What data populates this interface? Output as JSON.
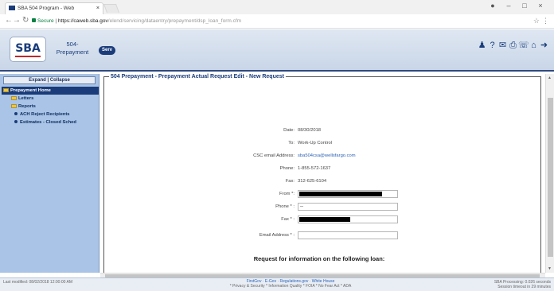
{
  "browser": {
    "tab_title": "SBA 504 Program - Web",
    "url_secure_label": "Secure",
    "url_host": "https://caweb.sba.gov",
    "url_path": "/elend/servicing/dataentry/prepayment/dsp_loan_form.cfm"
  },
  "header": {
    "logo_text": "SBA",
    "app_name_line1": "504-",
    "app_name_line2": "Prepayment",
    "serv_badge": "Serv",
    "icons": [
      "user-icon",
      "help-icon",
      "chat-icon",
      "print-icon",
      "phone-icon",
      "home-icon",
      "logout-icon"
    ]
  },
  "sidebar": {
    "expand_label": "Expand",
    "collapse_label": "Collapse",
    "home": "Prepayment Home",
    "items": [
      {
        "label": "Letters"
      },
      {
        "label": "Reports"
      },
      {
        "label": "ACH Reject Recipients"
      },
      {
        "label": "Estimates - Closed Sched"
      }
    ]
  },
  "form": {
    "legend": "504 Prepayment - Prepayment Actual Request Edit - New Request",
    "date_label": "Date:",
    "date_value": "08/30/2018",
    "to_label": "To:",
    "to_value": "Work-Up Control",
    "csc_email_label": "CSC email Address:",
    "csc_email_value": "sba504csa@wellsfargo.com",
    "phone_label": "Phone:",
    "phone_value": "1-855-572-1637",
    "fax_label": "Fax:",
    "fax_value": "312-625-6104",
    "from_label": "From *:",
    "phone_input_label": "Phone * :",
    "phone_input_value": "--",
    "fax_input_label": "Fax * :",
    "email_input_label": "Email Address * :",
    "loan_heading": "Request for information on the following loan:"
  },
  "footer": {
    "last_modified": "Last modified: 08/02/2018 12:00:00 AM",
    "links_line1": "FirstGov  ·  E-Gov  ·  Regulations.gov  ·  White House",
    "links_line2": "* Privacy & Security  * Information Quality  * FOIA  * No Fear Act  * ADA",
    "status_line1": "SBA Processing: 0.026 seconds",
    "status_line2": "Session timeout in 29 minutes"
  }
}
